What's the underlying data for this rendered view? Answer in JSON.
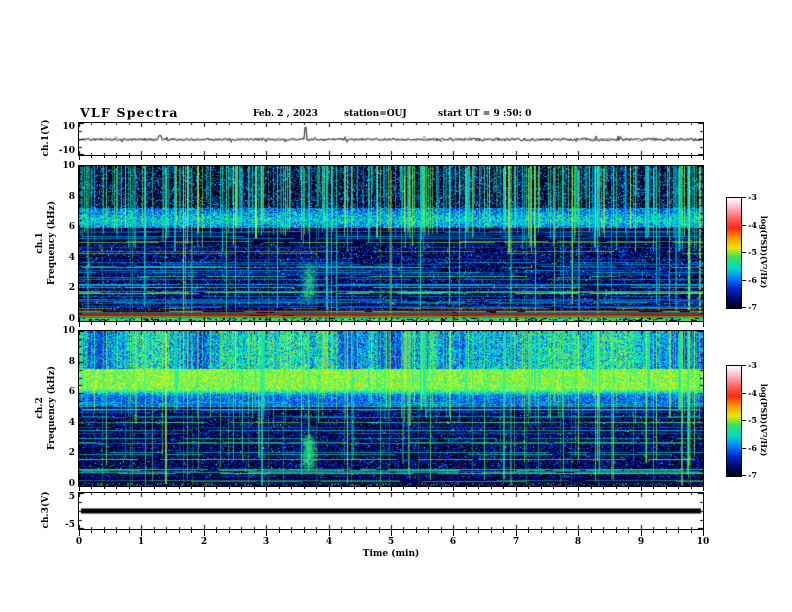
{
  "header": {
    "title": "VLF Spectra",
    "date": "Feb. 2  , 2023",
    "station": "station=OUJ",
    "start_ut": "start UT =   9 :50: 0"
  },
  "axes": {
    "x": {
      "label": "Time (min)",
      "ticks": [
        "0",
        "1",
        "2",
        "3",
        "4",
        "5",
        "6",
        "7",
        "8",
        "9",
        "10"
      ]
    },
    "wave1": {
      "ylabel": "ch.1(V)",
      "yticks": [
        "10",
        "-10"
      ]
    },
    "spec1": {
      "ylabel_line1": "ch.1",
      "ylabel_line2": "Frequency (kHz)",
      "yticks": [
        "0",
        "2",
        "4",
        "6",
        "8",
        "10"
      ]
    },
    "spec2": {
      "ylabel_line1": "ch.2",
      "ylabel_line2": "Frequency (kHz)",
      "yticks": [
        "0",
        "2",
        "4",
        "6",
        "8",
        "10"
      ]
    },
    "wave3": {
      "ylabel": "ch.3(V)",
      "yticks": [
        "5",
        "-5"
      ]
    }
  },
  "colorbar": {
    "label": "log(PSD)(V²/Hz)",
    "ticks": [
      "-3",
      "-4",
      "-5",
      "-6",
      "-7"
    ],
    "gradient_top_to_bottom": [
      "#ffffff",
      "#ffb4c8",
      "#ff6464",
      "#ff2814",
      "#ff9600",
      "#e6e600",
      "#32e164",
      "#00dcc8",
      "#0082ff",
      "#0028d2",
      "#000a78",
      "#00000a"
    ]
  },
  "chart_data": [
    {
      "type": "line",
      "name": "ch.1 voltage waveform",
      "ylabel": "ch.1(V)",
      "xlim": [
        0,
        10
      ],
      "ylim": [
        -10,
        10
      ],
      "signal": {
        "baseline_v": 0,
        "noise_peak_to_peak_v": 1.5,
        "spikes": [
          {
            "t_min": 3.63,
            "peak_v": 8
          },
          {
            "t_min": 1.3,
            "peak_v": 2.5
          }
        ]
      }
    },
    {
      "type": "heatmap",
      "name": "ch.1 spectrogram",
      "ylabel": "ch.1 Frequency (kHz)",
      "xlim": [
        0,
        10
      ],
      "ylim": [
        0,
        10
      ],
      "zlabel": "log(PSD)(V²/Hz)",
      "zlim": [
        -7,
        -3
      ],
      "features": [
        {
          "feature": "sferic vertical streaks",
          "f_range_khz": [
            4.5,
            10
          ],
          "density": "dense"
        },
        {
          "feature": "diffuse blue band",
          "f_range_khz": [
            6.1,
            7.3
          ]
        },
        {
          "feature": "narrowband horizontal lines",
          "f_range_khz": [
            0.3,
            6.0
          ],
          "count": 44
        },
        {
          "feature": "strong red line",
          "f_khz": 0.5
        },
        {
          "feature": "bright bottom band",
          "f_range_khz": [
            0.05,
            0.22
          ]
        },
        {
          "feature": "transient burst",
          "t_min": 3.67,
          "f_range_khz": [
            1.2,
            3.8
          ]
        }
      ]
    },
    {
      "type": "heatmap",
      "name": "ch.2 spectrogram",
      "ylabel": "ch.2 Frequency (kHz)",
      "xlim": [
        0,
        10
      ],
      "ylim": [
        0,
        10
      ],
      "zlabel": "log(PSD)(V²/Hz)",
      "zlim": [
        -7,
        -3
      ],
      "features": [
        {
          "feature": "dense green speckle",
          "f_range_khz": [
            7.55,
            10
          ]
        },
        {
          "feature": "bright green band",
          "f_range_khz": [
            6.3,
            7.25
          ]
        },
        {
          "feature": "narrowband horizontal lines",
          "f_range_khz": [
            0.3,
            5.6
          ],
          "count": 32
        },
        {
          "feature": "sferic vertical streaks",
          "f_range_khz": [
            3.8,
            10
          ],
          "density": "dense"
        },
        {
          "feature": "transient burst",
          "t_min": 3.67,
          "f_range_khz": [
            1.1,
            3.3
          ]
        }
      ]
    },
    {
      "type": "line",
      "name": "ch.3 voltage waveform",
      "ylabel": "ch.3(V)",
      "xlim": [
        0,
        10
      ],
      "ylim": [
        -5,
        5
      ],
      "signal": {
        "baseline_v": 0,
        "appearance": "flat thick saturated trace"
      }
    }
  ]
}
